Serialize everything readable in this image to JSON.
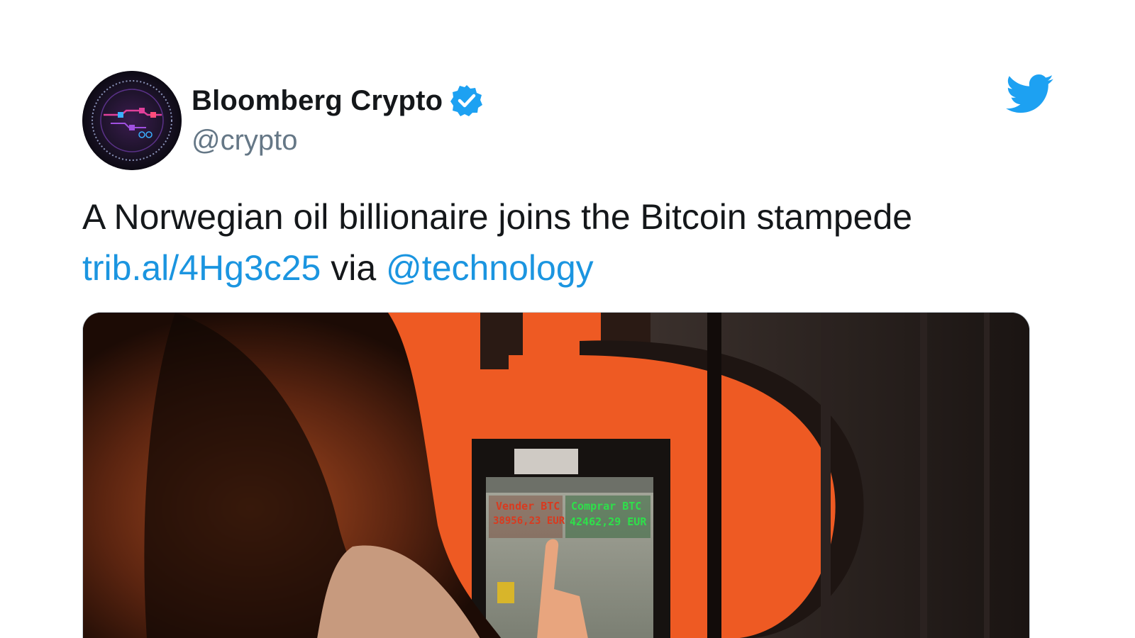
{
  "tweet": {
    "author": {
      "display_name": "Bloomberg Crypto",
      "handle": "@crypto",
      "verified": true,
      "avatar_icon": "bloomberg-crypto-logo"
    },
    "text": {
      "line1": "A Norwegian oil billionaire joins the Bitcoin stampede",
      "link": "trib.al/4Hg3c25",
      "via": "via",
      "mention": "@technology"
    },
    "platform_icon": "twitter-bird-icon",
    "media": {
      "atm_screen": {
        "sell_label": "Vender BTC",
        "sell_price": "38956,23 EUR",
        "buy_label": "Comprar BTC",
        "buy_price": "42462,29 EUR"
      }
    }
  },
  "colors": {
    "link": "#1b95e0",
    "verified": "#1da1f2",
    "twitter_blue": "#1da1f2",
    "text": "#14171a",
    "muted": "#657786"
  }
}
